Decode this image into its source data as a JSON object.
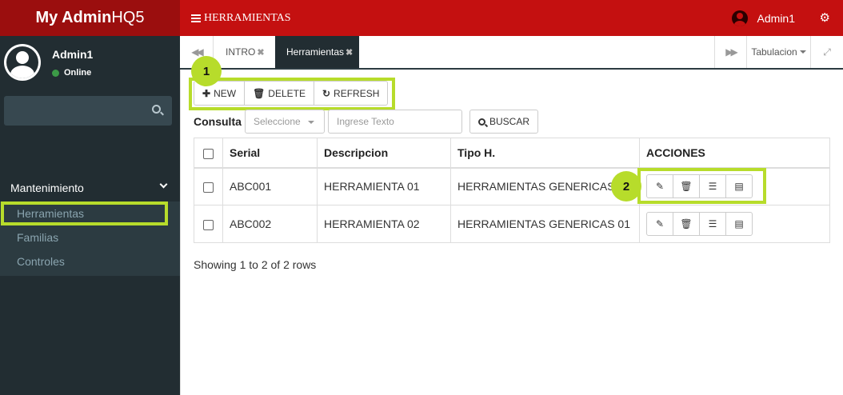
{
  "app": {
    "logo_bold": "My Admin",
    "logo_light": "HQ5"
  },
  "topbar": {
    "page_title": "HERRAMIENTAS",
    "username": "Admin1"
  },
  "sidebar": {
    "user_name": "Admin1",
    "user_status": "Online",
    "group_label": "Mantenimiento",
    "items": [
      {
        "label": "Herramientas"
      },
      {
        "label": "Familias"
      },
      {
        "label": "Controles"
      }
    ]
  },
  "tabs": {
    "items": [
      {
        "label": "INTRO"
      },
      {
        "label": "Herramientas"
      }
    ],
    "close_glyph": "✖",
    "tabulacion": "Tabulacion"
  },
  "toolbar": {
    "new_label": "NEW",
    "delete_label": "DELETE",
    "refresh_label": "REFRESH"
  },
  "annotations": {
    "badge1": "1",
    "badge2": "2",
    "highlight_color": "#b7dc2b"
  },
  "search": {
    "label": "Consulta",
    "select_value": "Seleccione",
    "input_placeholder": "Ingrese Texto",
    "button_label": "BUSCAR"
  },
  "table": {
    "headers": {
      "serial": "Serial",
      "descripcion": "Descripcion",
      "tipo": "Tipo H.",
      "acciones": "ACCIONES"
    },
    "rows": [
      {
        "serial": "ABC001",
        "descripcion": "HERRAMIENTA 01",
        "tipo": "HERRAMIENTAS GENERICAS 01"
      },
      {
        "serial": "ABC002",
        "descripcion": "HERRAMIENTA 02",
        "tipo": "HERRAMIENTAS GENERICAS 01"
      }
    ]
  },
  "footer": {
    "showing": "Showing 1 to 2 of 2 rows"
  },
  "colors": {
    "topbar": "#c41010",
    "logo_bg": "#9b0e0e",
    "sidebar": "#222d32",
    "submenu": "#2c3b41"
  }
}
